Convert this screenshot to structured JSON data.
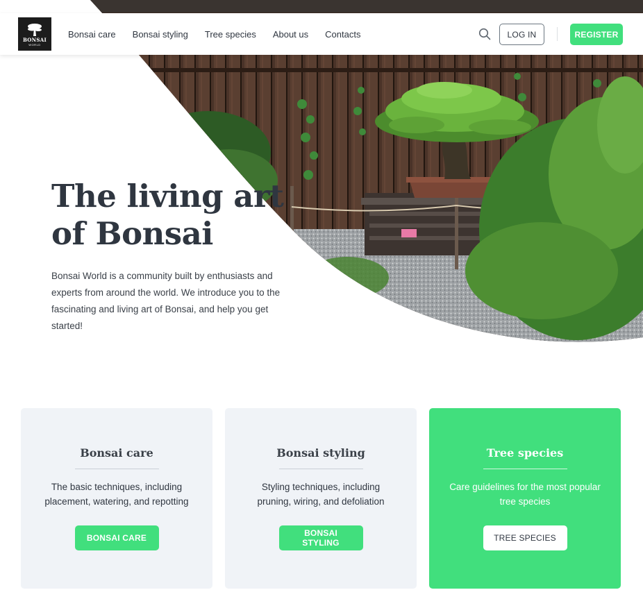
{
  "header": {
    "logo": {
      "text": "BONSAI",
      "sub": "WORLD"
    },
    "nav": [
      "Bonsai care",
      "Bonsai styling",
      "Tree species",
      "About us",
      "Contacts"
    ],
    "search_icon": "search-icon",
    "login_label": "LOG IN",
    "register_label": "REGISTER"
  },
  "hero": {
    "title_line1": "The living art",
    "title_line2": "of Bonsai",
    "description": "Bonsai World is a community built by enthusiasts and experts from around the world. We introduce you to the fascinating and living art of Bonsai, and help you get started!"
  },
  "cards": [
    {
      "title": "Bonsai care",
      "description": "The basic techniques, including placement, watering, and repotting",
      "button": "BONSAI CARE"
    },
    {
      "title": "Bonsai styling",
      "description": "Styling techniques, including pruning, wiring, and defoliation",
      "button": "BONSAI STYLING"
    },
    {
      "title": "Tree species",
      "description": "Care guidelines for the most popular tree species",
      "button": "TREE SPECIES"
    }
  ],
  "colors": {
    "accent": "#41df7d",
    "text": "#2f3640",
    "card_bg": "#f0f3f7"
  }
}
